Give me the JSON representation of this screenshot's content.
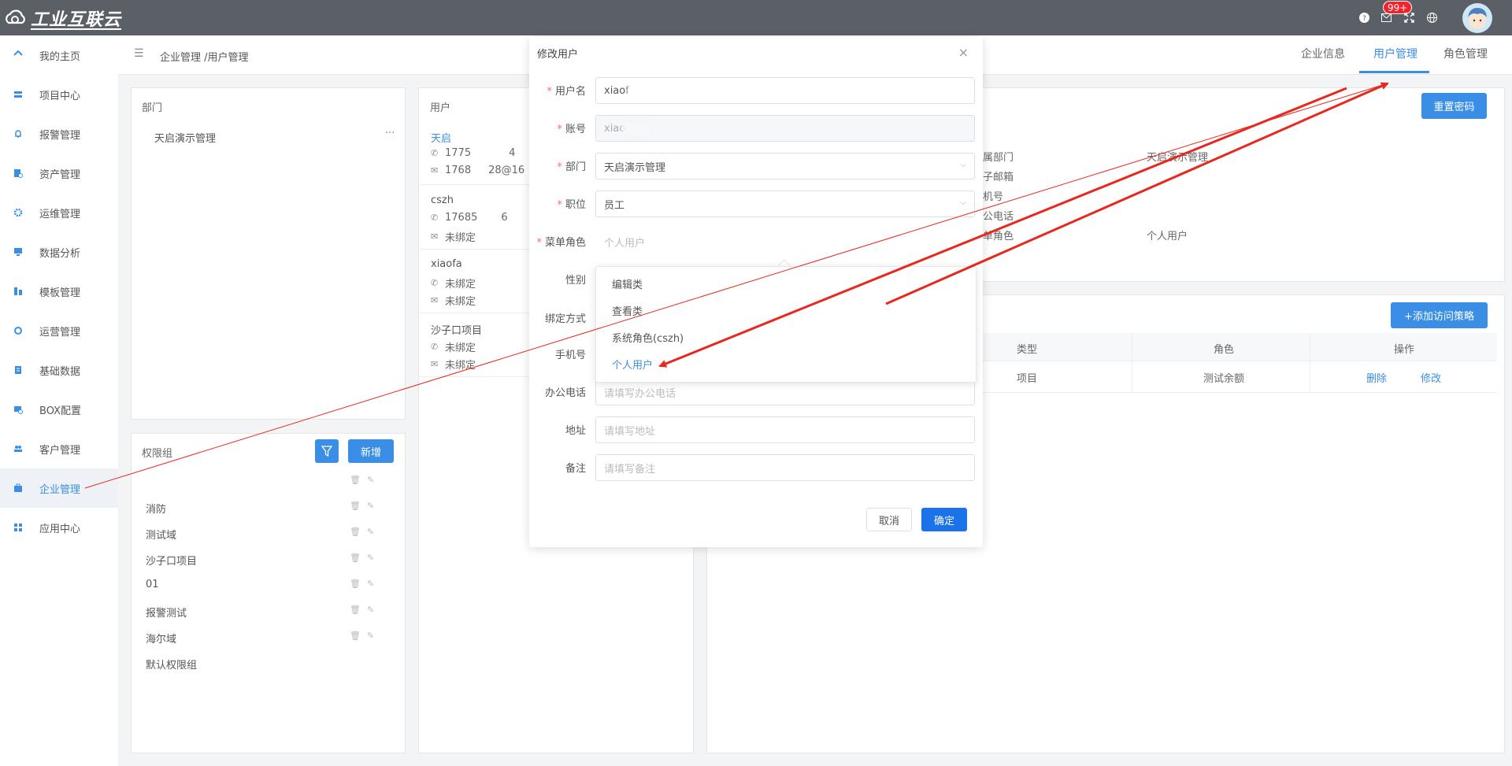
{
  "app": {
    "logo_text": "工业互联云",
    "notification_count": "99+"
  },
  "sidebar": {
    "items": [
      {
        "label": "我的主页",
        "icon": "home-icon"
      },
      {
        "label": "项目中心",
        "icon": "layers-icon"
      },
      {
        "label": "报警管理",
        "icon": "bell-icon"
      },
      {
        "label": "资产管理",
        "icon": "asset-icon"
      },
      {
        "label": "运维管理",
        "icon": "gear-icon"
      },
      {
        "label": "数据分析",
        "icon": "monitor-icon"
      },
      {
        "label": "模板管理",
        "icon": "template-icon"
      },
      {
        "label": "运营管理",
        "icon": "cycle-icon"
      },
      {
        "label": "基础数据",
        "icon": "database-icon"
      },
      {
        "label": "BOX配置",
        "icon": "box-icon"
      },
      {
        "label": "客户管理",
        "icon": "users-icon"
      },
      {
        "label": "企业管理",
        "icon": "briefcase-icon"
      },
      {
        "label": "应用中心",
        "icon": "apps-icon"
      }
    ],
    "active_index": 11
  },
  "header": {
    "breadcrumb": "企业管理 /用户管理",
    "tabs": [
      {
        "label": "企业信息"
      },
      {
        "label": "用户管理"
      },
      {
        "label": "角色管理"
      }
    ],
    "active_tab": 1
  },
  "dept_panel": {
    "title": "部门",
    "items": [
      {
        "label": "天启演示管理",
        "more": "···"
      }
    ]
  },
  "perm_panel": {
    "title": "权限组",
    "add_label": "新增",
    "rows": [
      "",
      "消防",
      "测试域",
      "沙子口项目",
      "01",
      "报警测试",
      "海尔域",
      "默认权限组"
    ]
  },
  "user_panel": {
    "title": "用户",
    "users": [
      {
        "name": "天启",
        "phone": "1775",
        "phone_tail": "4",
        "email": "1768",
        "email_tail": "28@16"
      },
      {
        "name": "cszh",
        "phone": "17685",
        "phone_tail": "6",
        "email": "未绑定"
      },
      {
        "name": "xiaofa",
        "phone": "未绑定",
        "email": "未绑定"
      },
      {
        "name": "沙子口项目",
        "phone": "未绑定",
        "email": "未绑定"
      }
    ]
  },
  "detail_panel": {
    "reset_label": "重置密码",
    "labels": [
      "属部门",
      "子邮箱",
      "机号",
      "公电话",
      "单角色"
    ],
    "dept_value": "天启演示管理",
    "role_value": "个人用户"
  },
  "policy_panel": {
    "add_label": "+添加访问策略",
    "columns": [
      "类型",
      "角色",
      "操作"
    ],
    "rows": [
      {
        "type": "项目",
        "role": "测试余额",
        "delete": "删除",
        "edit": "修改"
      }
    ]
  },
  "modal": {
    "title": "修改用户",
    "close": "×",
    "fields": {
      "username": {
        "label": "用户名",
        "value": "xiaof"
      },
      "account": {
        "label": "账号",
        "value": "xiao"
      },
      "dept": {
        "label": "部门",
        "value": "天启演示管理"
      },
      "position": {
        "label": "职位",
        "value": "员工"
      },
      "menu_role": {
        "label": "菜单角色",
        "placeholder": "个人用户"
      },
      "gender": {
        "label": "性别"
      },
      "bind_method": {
        "label": "绑定方式"
      },
      "phone": {
        "label": "手机号"
      },
      "office_phone": {
        "label": "办公电话",
        "placeholder": "请填写办公电话"
      },
      "address": {
        "label": "地址",
        "placeholder": "请填写地址"
      },
      "remark": {
        "label": "备注",
        "placeholder": "请填写备注"
      }
    },
    "cancel_label": "取消",
    "confirm_label": "确定"
  },
  "role_dropdown": {
    "options": [
      "编辑类",
      "查看类",
      "系统角色(cszh)",
      "个人用户"
    ],
    "selected_index": 3
  },
  "colors": {
    "accent": "#3a8ee6",
    "topbar": "#5b5f66",
    "badge": "#f5222d",
    "annotation": "#e8281e"
  }
}
